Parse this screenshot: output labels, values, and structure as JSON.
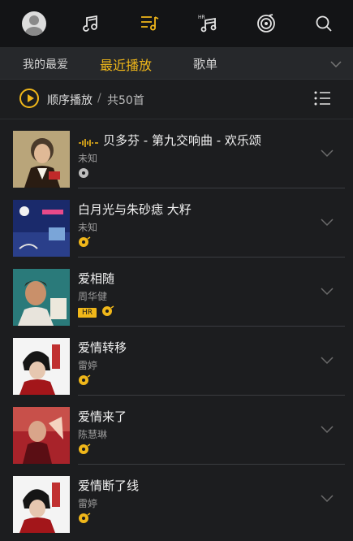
{
  "topbar": {
    "icons": [
      "avatar",
      "music-note-icon",
      "playlist-icon",
      "hr-music-icon",
      "radio-icon",
      "search-icon"
    ],
    "active": "playlist-icon",
    "accent": "#f0b71a"
  },
  "tabs": {
    "fav": "我的最爱",
    "recent": "最近播放",
    "songs": "歌单"
  },
  "playbar": {
    "mode": "顺序播放",
    "separator": "/",
    "count": "共50首"
  },
  "songs": [
    {
      "title": "贝多芬 - 第九交响曲 - 欢乐颂",
      "artist": "未知",
      "playing": true,
      "hr": false,
      "icon": "disc-icon"
    },
    {
      "title": "白月光与朱砂痣  大籽",
      "artist": "未知",
      "playing": false,
      "hr": false,
      "icon": "music-disc-icon"
    },
    {
      "title": "爱相随",
      "artist": "周华健",
      "playing": false,
      "hr": true,
      "hr_label": "HR",
      "icon": "music-disc-icon"
    },
    {
      "title": "爱情转移",
      "artist": "雷婷",
      "playing": false,
      "hr": false,
      "icon": "music-disc-icon"
    },
    {
      "title": "爱情来了",
      "artist": "陈慧琳",
      "playing": false,
      "hr": false,
      "icon": "music-disc-icon"
    },
    {
      "title": "爱情断了线",
      "artist": "雷婷",
      "playing": false,
      "hr": false,
      "icon": "music-disc-icon"
    }
  ]
}
